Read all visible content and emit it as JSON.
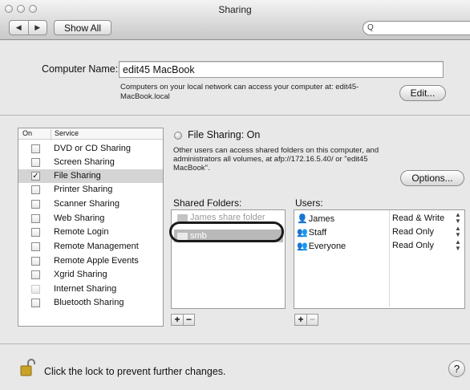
{
  "window": {
    "title": "Sharing"
  },
  "toolbar": {
    "back_icon": "◀",
    "forward_icon": "▶",
    "show_all_label": "Show All",
    "search_placeholder": "",
    "search_icon": "Q"
  },
  "computer_name": {
    "label": "Computer Name:",
    "value": "edit45 MacBook",
    "note": "Computers on your local network can access your computer at: edit45-MacBook.local",
    "edit_label": "Edit..."
  },
  "services": {
    "header_on": "On",
    "header_service": "Service",
    "items": [
      {
        "label": "DVD or CD Sharing",
        "checked": false
      },
      {
        "label": "Screen Sharing",
        "checked": false
      },
      {
        "label": "File Sharing",
        "checked": true,
        "selected": true
      },
      {
        "label": "Printer Sharing",
        "checked": false
      },
      {
        "label": "Scanner Sharing",
        "checked": false
      },
      {
        "label": "Web Sharing",
        "checked": false
      },
      {
        "label": "Remote Login",
        "checked": false
      },
      {
        "label": "Remote Management",
        "checked": false
      },
      {
        "label": "Remote Apple Events",
        "checked": false
      },
      {
        "label": "Xgrid Sharing",
        "checked": false
      },
      {
        "label": "Internet Sharing",
        "checked": false,
        "dimmed": true
      },
      {
        "label": "Bluetooth Sharing",
        "checked": false
      }
    ]
  },
  "file_sharing": {
    "status": "File Sharing: On",
    "description": "Other users can access shared folders on this computer, and administrators all volumes, at afp://172.16.5.40/ or \"edit45 MacBook\".",
    "options_label": "Options..."
  },
  "shared_folders": {
    "label": "Shared Folders:",
    "items": [
      {
        "name": "James share folder"
      },
      {
        "name": "smb"
      }
    ],
    "add": "+",
    "remove": "−"
  },
  "users": {
    "label": "Users:",
    "items": [
      {
        "name": "James",
        "permission": "Read & Write"
      },
      {
        "name": "Staff",
        "permission": "Read Only"
      },
      {
        "name": "Everyone",
        "permission": "Read Only"
      }
    ],
    "add": "+",
    "remove": "−"
  },
  "footer": {
    "lock_text": "Click the lock to prevent further changes.",
    "help": "?"
  }
}
